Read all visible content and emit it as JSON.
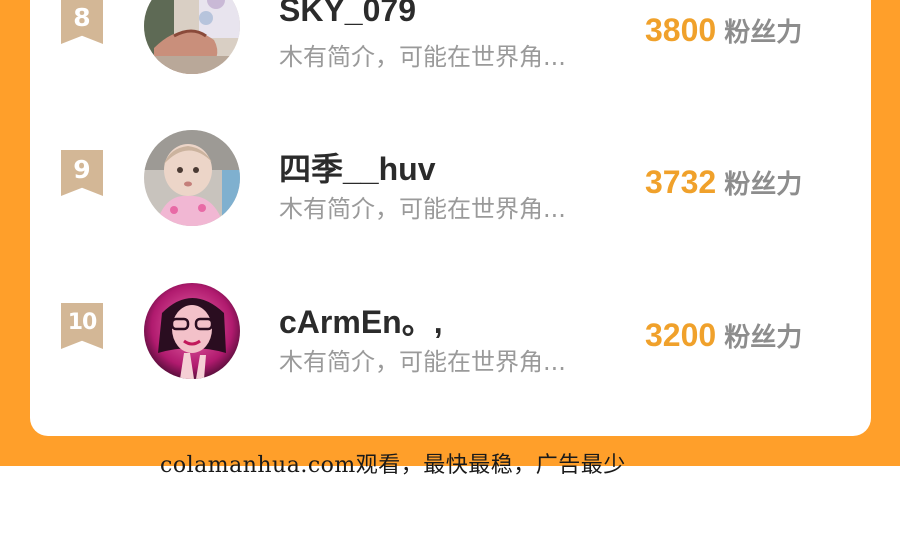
{
  "leaderboard": {
    "rows": [
      {
        "rank": "8",
        "name": "SKY_079",
        "bio": "木有简介，可能在世界角...",
        "fans_count": "3800",
        "fans_unit": "粉丝力"
      },
      {
        "rank": "9",
        "name": "四季__huv",
        "bio": "木有简介，可能在世界角...",
        "fans_count": "3732",
        "fans_unit": "粉丝力"
      },
      {
        "rank": "10",
        "name": "cArmEn。,",
        "bio": "木有简介，可能在世界角...",
        "fans_count": "3200",
        "fans_unit": "粉丝力"
      }
    ]
  },
  "watermark": {
    "text": "colamanhua.com观看，最快最稳，广告最少"
  },
  "colors": {
    "background_accent": "#FF9F2A",
    "rank_badge": "#D3B796",
    "fans_number": "#F0A12B",
    "bio_text": "#9a9a9a"
  }
}
